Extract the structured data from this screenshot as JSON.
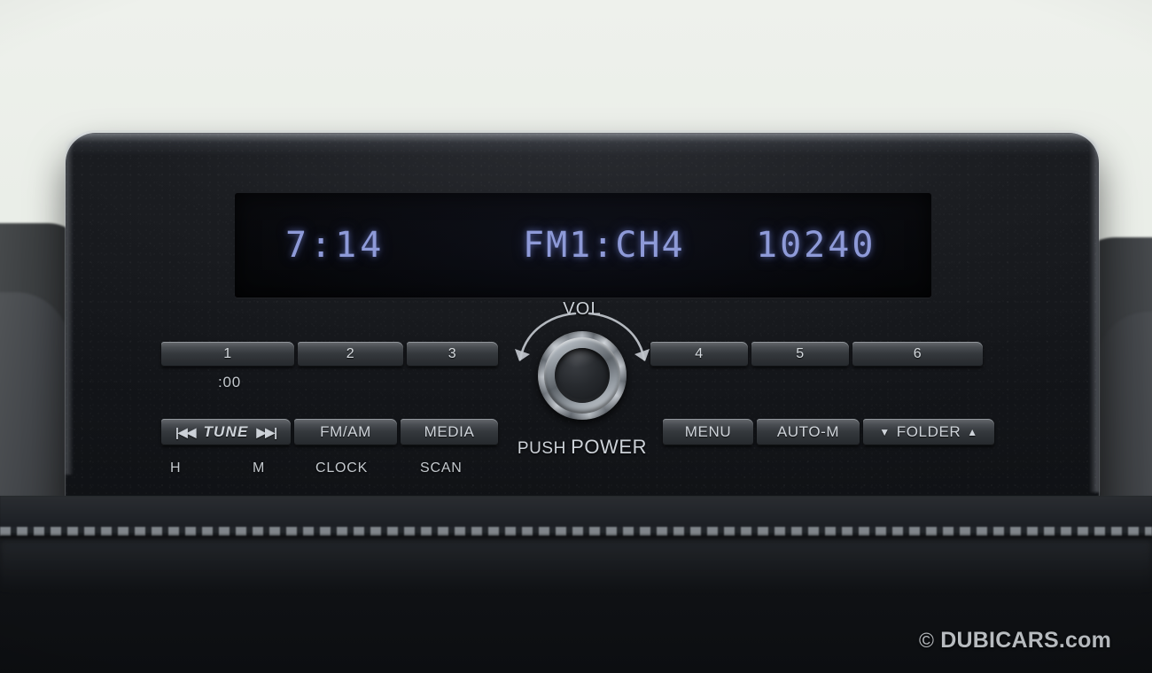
{
  "watermark": {
    "symbol": "©",
    "brand": "DUBICARS.com"
  },
  "display": {
    "clock": "7:14",
    "source": "FM1:CH4",
    "frequency": "10240",
    "segment_color": "#8e9ad8",
    "panel_color": "#07080b"
  },
  "presets_left": [
    {
      "label": "1",
      "sub": ":00"
    },
    {
      "label": "2",
      "sub": ""
    },
    {
      "label": "3",
      "sub": ""
    }
  ],
  "presets_right": [
    {
      "label": "4"
    },
    {
      "label": "5"
    },
    {
      "label": "6"
    }
  ],
  "function_row_left": [
    {
      "label": "TUNE",
      "icon_prev": "|◀◀",
      "icon_next": "▶▶|",
      "sub_a": "H",
      "sub_b": "M"
    },
    {
      "label": "FM/AM",
      "sub": "CLOCK"
    },
    {
      "label": "MEDIA",
      "sub": "SCAN"
    }
  ],
  "function_row_right": [
    {
      "label": "MENU"
    },
    {
      "label": "AUTO-M"
    },
    {
      "label": "FOLDER",
      "arrow_down": "▼",
      "arrow_up": "▲"
    }
  ],
  "knob": {
    "label": "VOL",
    "push_prefix": "PUSH",
    "push_suffix": "POWER"
  }
}
